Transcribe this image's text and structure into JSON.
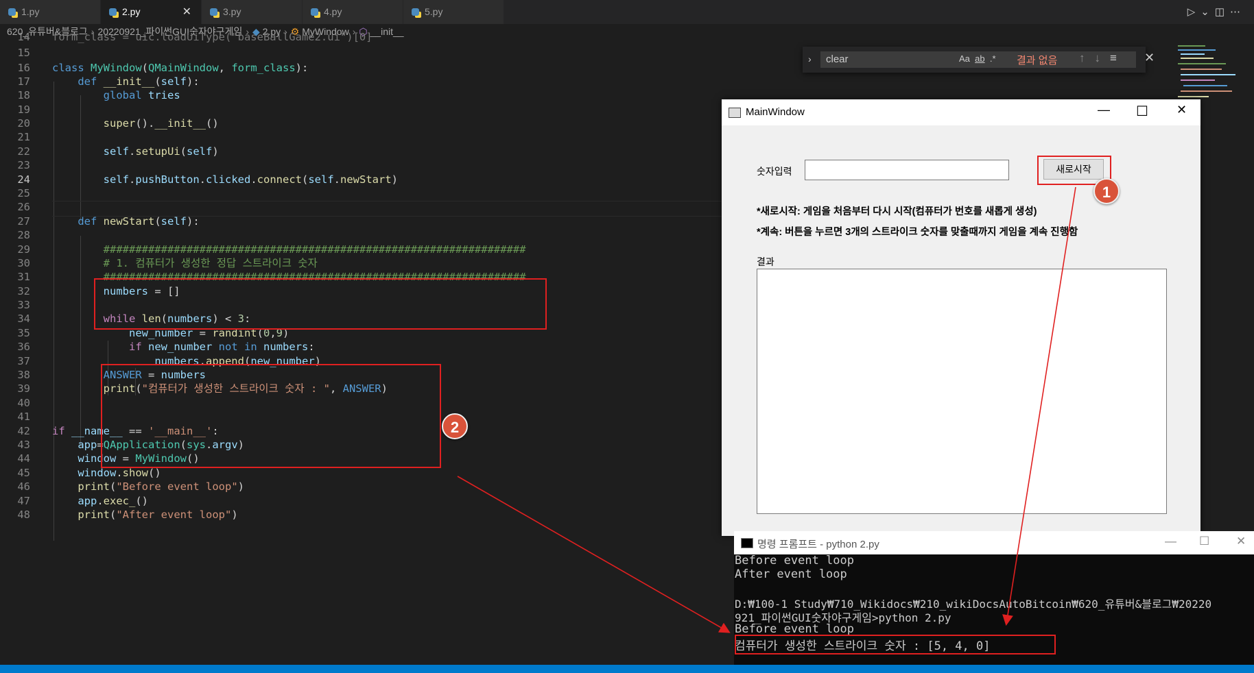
{
  "tabs": [
    {
      "label": "1.py",
      "active": false
    },
    {
      "label": "2.py",
      "active": true
    },
    {
      "label": "3.py",
      "active": false
    },
    {
      "label": "4.py",
      "active": false
    },
    {
      "label": "5.py",
      "active": false
    }
  ],
  "breadcrumb": {
    "folder": "620_유튜버&블로그",
    "subfolder": "20220921_파이썬GUI숫자야구게임",
    "file": "2.py",
    "class": "MyWindow",
    "method": "__init__"
  },
  "find": {
    "query": "clear",
    "case_option": "Aa",
    "word_option": "ab",
    "regex_option": ".*",
    "no_results": "결과 없음"
  },
  "editor": {
    "line_numbers": [
      "14",
      "15",
      "16",
      "17",
      "18",
      "19",
      "20",
      "21",
      "22",
      "23",
      "24",
      "25",
      "26",
      "27",
      "28",
      "29",
      "30",
      "31",
      "32",
      "33",
      "34",
      "35",
      "36",
      "37",
      "38",
      "39",
      "40",
      "41",
      "42",
      "43",
      "44",
      "45",
      "46",
      "47",
      "48"
    ],
    "current_line": "24",
    "code": {
      "l14": "form_class = uic.loadUiType(\"baseBallGame2.ui\")[0]",
      "l16_kw": "class",
      "l16_name": "MyWindow",
      "l16_p1": "QMainWindow",
      "l16_p2": "form_class",
      "l17_kw": "def",
      "l17_name": "__init__",
      "l17_arg": "self",
      "l18_kw": "global",
      "l18_var": "tries",
      "l20_fn": "super",
      "l20_method": "__init__",
      "l22_self": "self",
      "l22_method": "setupUi",
      "l22_arg": "self",
      "l24_self": "self",
      "l24_attr": "pushButton",
      "l24_attr2": "clicked",
      "l24_method": "connect",
      "l24_arg_self": "self",
      "l24_arg": "newStart",
      "l27_kw": "def",
      "l27_name": "newStart",
      "l27_arg": "self",
      "l29": "##################################################################",
      "l30": "# 1. 컴퓨터가 생성한 정답 스트라이크 숫자",
      "l31": "##################################################################",
      "l32_var": "numbers",
      "l32_rest": " = []",
      "l34_kw": "while",
      "l34_fn": "len",
      "l34_var": "numbers",
      "l34_num": "3",
      "l35_var": "new_number",
      "l35_fn": "randint",
      "l35_n1": "0",
      "l35_n2": "9",
      "l36_kw": "if",
      "l36_var": "new_number",
      "l36_kw2": "not",
      "l36_kw3": "in",
      "l36_var2": "numbers",
      "l37_var": "numbers",
      "l37_fn": "append",
      "l37_arg": "new_number",
      "l38_const": "ANSWER",
      "l38_var": "numbers",
      "l39_fn": "print",
      "l39_str": "\"컴퓨터가 생성한 스트라이크 숫자 : \"",
      "l39_const": "ANSWER",
      "l42_kw": "if",
      "l42_var": "__name__",
      "l42_str": "'__main__'",
      "l43_var": "app",
      "l43_cls": "QApplication",
      "l43_mod": "sys",
      "l43_attr": "argv",
      "l44_var": "window",
      "l44_cls": "MyWindow",
      "l45_var": "window",
      "l45_fn": "show",
      "l46_fn": "print",
      "l46_str": "\"Before event loop\"",
      "l47_var": "app",
      "l47_fn": "exec_",
      "l48_fn": "print",
      "l48_str": "\"After event loop\""
    }
  },
  "annotations": {
    "badge1": "1",
    "badge2": "2"
  },
  "qt_window": {
    "title": "MainWindow",
    "input_label": "숫자입력",
    "button_label": "새로시작",
    "desc1": "*새로시작: 게임을 처음부터 다시 시작(컴퓨터가 번호를 새롭게 생성)",
    "desc2": "*계속: 버튼을 누르면 3개의 스트라이크 숫자를 맞출때까지 게임을 계속 진행함",
    "result_label": "결과"
  },
  "console": {
    "title": "명령 프롬프트 - python  2.py",
    "lines": [
      "Before event loop",
      "After event loop",
      "",
      "D:₩100-1 Study₩710_Wikidocs₩210_wikiDocsAutoBitcoin₩620_유튜버&블로그₩20220",
      "921_파이썬GUI숫자야구게임>python 2.py",
      "Before event loop",
      "컴퓨터가 생성한 스트라이크 숫자 :  [5, 4, 0]"
    ]
  },
  "colors": {
    "editor_bg": "#1e1e1e",
    "keyword": "#569cd6",
    "class": "#4ec9b0",
    "function": "#dcdcaa",
    "string": "#ce9178",
    "comment": "#6a9955",
    "variable": "#9cdcfe",
    "annotation_red": "#e02020",
    "badge": "#d9533a",
    "statusbar": "#007acc"
  }
}
